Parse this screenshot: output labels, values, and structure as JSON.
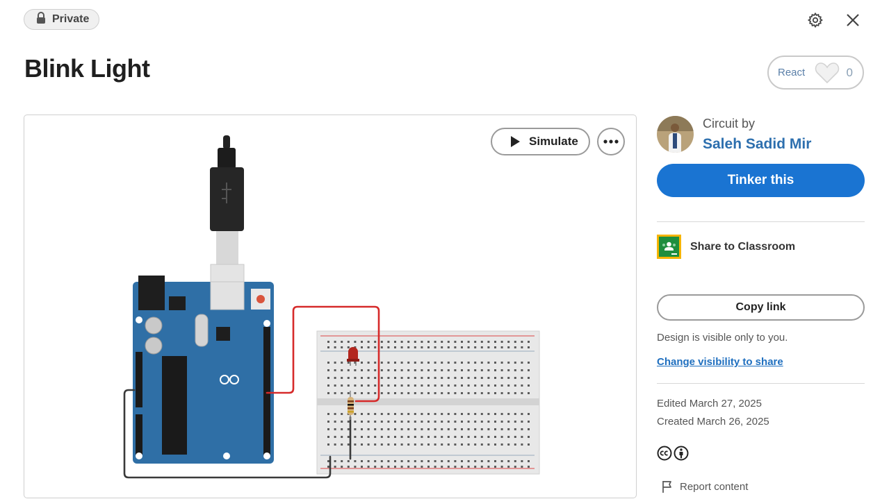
{
  "header": {
    "privacy_label": "Private",
    "privacy_icon": "lock-icon",
    "settings_icon": "gear-icon",
    "close_icon": "close-icon"
  },
  "design": {
    "title": "Blink Light",
    "react_label": "React",
    "react_count": "0"
  },
  "viewer": {
    "simulate_label": "Simulate"
  },
  "sidebar": {
    "circuit_by_label": "Circuit by",
    "author_name": "Saleh Sadid Mir",
    "tinker_label": "Tinker this",
    "share_classroom_label": "Share to Classroom",
    "copy_link_label": "Copy link",
    "visibility_note": "Design is visible only to you.",
    "change_visibility_label": "Change visibility to share",
    "edited": "Edited March 27, 2025",
    "created": "Created March 26, 2025",
    "report_label": "Report content"
  },
  "colors": {
    "accent": "#1a74d2",
    "link": "#2d6fae",
    "arduino_blue": "#2f6fa6",
    "wire_red": "#d62a2a"
  }
}
